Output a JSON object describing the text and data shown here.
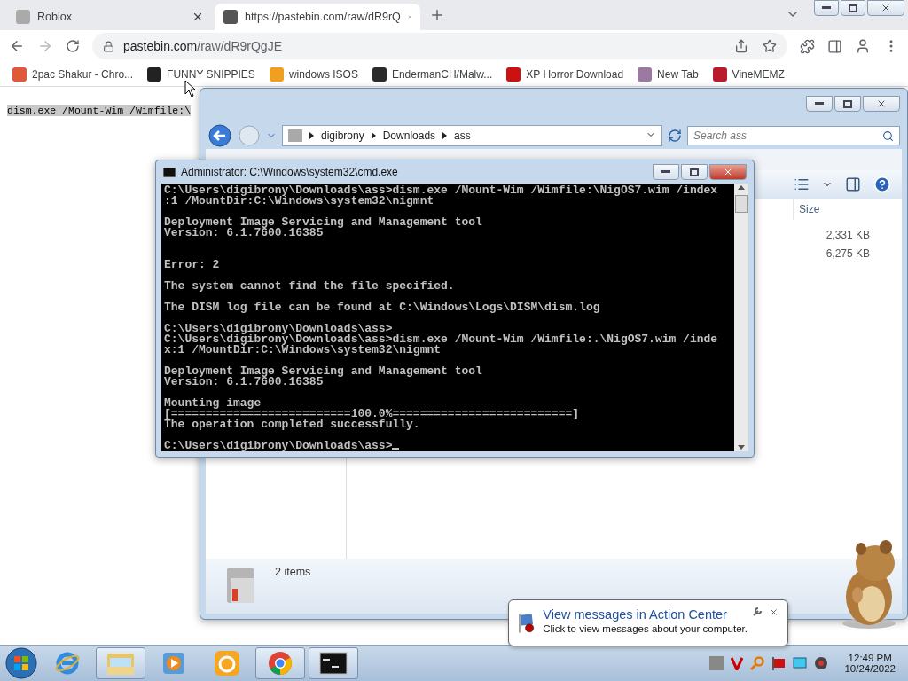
{
  "browser": {
    "tabs": [
      {
        "title": "Roblox",
        "selected": false
      },
      {
        "title": "https://pastebin.com/raw/dR9rQ",
        "selected": true
      }
    ],
    "url_host": "pastebin.com",
    "url_path": "/raw/dR9rQgJE",
    "bookmarks": [
      {
        "label": "2pac Shakur - Chro...",
        "color": "#e0583a"
      },
      {
        "label": "FUNNY SNIPPIES",
        "color": "#222222"
      },
      {
        "label": "windows ISOS",
        "color": "#f0a020"
      },
      {
        "label": "EndermanCH/Malw...",
        "color": "#2a2a2a"
      },
      {
        "label": "XP Horror Download",
        "color": "#cc1111"
      },
      {
        "label": "New Tab",
        "color": "#9a7aa0"
      },
      {
        "label": "VineMEMZ",
        "color": "#b81c2c"
      }
    ]
  },
  "page": {
    "selected_text": "dism.exe /Mount-Wim /Wimfile:\\"
  },
  "explorer": {
    "breadcrumb": [
      "digibrony",
      "Downloads",
      "ass"
    ],
    "search_placeholder": "Search ass",
    "column": "Size",
    "sizes": [
      "2,331 KB",
      "6,275 KB"
    ],
    "status": "2 items"
  },
  "cmd": {
    "title": "Administrator: C:\\Windows\\system32\\cmd.exe",
    "lines": [
      {
        "kind": "text",
        "text": "C:\\Users\\digibrony\\Downloads\\ass>dism.exe /Mount-Wim /Wimfile:\\NigOS7.wim /index"
      },
      {
        "kind": "text",
        "text": ":1 /MountDir:C:\\Windows\\system32\\nigmnt"
      },
      {
        "kind": "blank"
      },
      {
        "kind": "text",
        "text": "Deployment Image Servicing and Management tool"
      },
      {
        "kind": "text",
        "text": "Version: 6.1.7600.16385"
      },
      {
        "kind": "blank"
      },
      {
        "kind": "blank"
      },
      {
        "kind": "text",
        "text": "Error: 2"
      },
      {
        "kind": "blank"
      },
      {
        "kind": "text",
        "text": "The system cannot find the file specified."
      },
      {
        "kind": "blank"
      },
      {
        "kind": "text",
        "text": "The DISM log file can be found at C:\\Windows\\Logs\\DISM\\dism.log"
      },
      {
        "kind": "blank"
      },
      {
        "kind": "text",
        "text": "C:\\Users\\digibrony\\Downloads\\ass>"
      },
      {
        "kind": "text",
        "text": "C:\\Users\\digibrony\\Downloads\\ass>dism.exe /Mount-Wim /Wimfile:.\\NigOS7.wim /inde"
      },
      {
        "kind": "text",
        "text": "x:1 /MountDir:C:\\Windows\\system32\\nigmnt"
      },
      {
        "kind": "blank"
      },
      {
        "kind": "text",
        "text": "Deployment Image Servicing and Management tool"
      },
      {
        "kind": "text",
        "text": "Version: 6.1.7600.16385"
      },
      {
        "kind": "blank"
      },
      {
        "kind": "text",
        "text": "Mounting image"
      },
      {
        "kind": "text",
        "text": "[==========================100.0%==========================]"
      },
      {
        "kind": "text",
        "text": "The operation completed successfully."
      },
      {
        "kind": "blank"
      },
      {
        "kind": "prompt",
        "text": "C:\\Users\\digibrony\\Downloads\\ass>"
      }
    ]
  },
  "notification": {
    "title": "View messages in Action Center",
    "body": "Click to view messages about your computer."
  },
  "taskbar": {
    "apps": [
      {
        "kind": "ie",
        "running": false
      },
      {
        "kind": "explorer",
        "running": true
      },
      {
        "kind": "media",
        "running": false
      },
      {
        "kind": "uc",
        "running": false
      },
      {
        "kind": "chrome",
        "running": true
      },
      {
        "kind": "cmd",
        "running": true
      }
    ],
    "time": "12:49 PM",
    "date": "10/24/2022"
  }
}
